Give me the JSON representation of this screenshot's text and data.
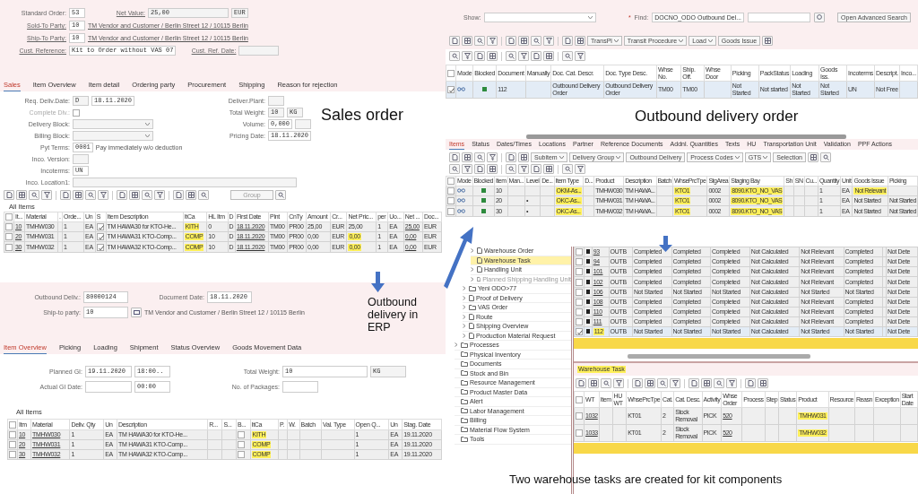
{
  "sales_order": {
    "header_rows": [
      [
        {
          "kind": "input",
          "label": "Standard Order:",
          "link": false,
          "value": "53"
        },
        {
          "kind": "input",
          "label": "Net Value:",
          "link": true,
          "value": "25,00",
          "unit": "EUR"
        }
      ],
      [
        {
          "kind": "input",
          "label": "Sold-To Party:",
          "link": true,
          "value": "10",
          "text": "TM Vendor and Customer / Berlin Street 12 / 10115 Berlin"
        }
      ],
      [
        {
          "kind": "input",
          "label": "Ship-To Party:",
          "link": true,
          "value": "10",
          "text": "TM Vendor and Customer / Berlin Street 12 / 10115 Berlin"
        }
      ],
      [
        {
          "kind": "input",
          "label": "Cust. Reference:",
          "link": true,
          "value": "Kit to Order without VAS 07"
        },
        {
          "kind": "input",
          "label": "Cust. Ref. Date:",
          "link": true
        }
      ]
    ],
    "tabs": [
      {
        "label": "Sales",
        "selected": true
      },
      {
        "label": "Item Overview",
        "selected": false
      },
      {
        "label": "Item detail",
        "selected": false
      },
      {
        "label": "Ordering party",
        "selected": false
      },
      {
        "label": "Procurement",
        "selected": false
      },
      {
        "label": "Shipping",
        "selected": false
      },
      {
        "label": "Reason for rejection",
        "selected": false
      }
    ],
    "form_left": [
      {
        "kind": "input",
        "label": "Req. Deliv.Date:",
        "prefix": "D",
        "value": "18.11.2020"
      },
      {
        "kind": "checkbox",
        "label": "Complete Dlv.:",
        "checked": false,
        "disabled": true
      },
      {
        "kind": "dropdown",
        "label": "Delivery Block:"
      },
      {
        "kind": "dropdown",
        "label": "Billing Block:"
      },
      {
        "kind": "input",
        "label": "Pyt Terms:",
        "value": "0001",
        "text": "Pay immediately w/o deduction"
      },
      {
        "kind": "input",
        "label": "Inco. Version:"
      },
      {
        "kind": "input",
        "label": "Incoterms:",
        "value": "UN"
      },
      {
        "kind": "wide-input",
        "label": "Inco. Location1:"
      }
    ],
    "form_right": [
      {
        "kind": "input",
        "label": "Deliver.Plant:"
      },
      {
        "kind": "input",
        "label": "Total Weight:",
        "value": "10",
        "unit": "KG"
      },
      {
        "kind": "input",
        "label": "Volume:",
        "value": "0,000",
        "unit_box": true
      },
      {
        "kind": "input",
        "label": "Pricing Date:",
        "value": "18.11.2020"
      }
    ],
    "toolbar_buttons": [
      {
        "label": "Group",
        "dropdown": false
      }
    ],
    "table_title": "All Items",
    "table": {
      "row_select": true,
      "all_checked": false,
      "columns": [
        {
          "label": "It...",
          "kind": "link"
        },
        {
          "label": "Material",
          "kind": "text"
        },
        {
          "label": ".",
          "kind": "text"
        },
        {
          "label": "Orde...",
          "kind": "text"
        },
        {
          "label": "Un",
          "kind": "text"
        },
        {
          "label": "S",
          "kind": "check"
        },
        {
          "label": "Item Description",
          "kind": "text"
        },
        {
          "label": "ItCa",
          "kind": "text"
        },
        {
          "label": "HL Itm",
          "kind": "text"
        },
        {
          "label": "D",
          "kind": "text"
        },
        {
          "label": "First Date",
          "kind": "link"
        },
        {
          "label": "Plnt",
          "kind": "text"
        },
        {
          "label": "CnTy",
          "kind": "text"
        },
        {
          "label": "Amount",
          "kind": "text"
        },
        {
          "label": "Cr...",
          "kind": "text"
        },
        {
          "label": "Net Pric...",
          "kind": "text"
        },
        {
          "label": "per",
          "kind": "text"
        },
        {
          "label": "Uo...",
          "kind": "text"
        },
        {
          "label": "Net ...",
          "kind": "link"
        },
        {
          "label": "Doc...",
          "kind": "text"
        }
      ],
      "rows": [
        {
          "checked": false,
          "cells": [
            "10",
            "TMHW030",
            null,
            "1",
            "EA",
            true,
            "TM HAWA30 for KTO-He...",
            {
              "text": "KITH",
              "highlighted": true
            },
            "0",
            "D",
            "18.11.2020",
            "TM00",
            "PR00",
            "25,00",
            "EUR",
            "25,00",
            "1",
            "EA",
            "25,00",
            "EUR"
          ]
        },
        {
          "checked": false,
          "cells": [
            "20",
            "TMHW031",
            null,
            "1",
            "EA",
            true,
            "TM HAWA31 KTO-Comp...",
            {
              "text": "COMP",
              "highlighted": true
            },
            "10",
            "D",
            "18.11.2020",
            "TM00",
            "PR00",
            "0,00",
            "EUR",
            {
              "text": "0,00",
              "highlighted": true
            },
            "1",
            "EA",
            "0,00",
            "EUR"
          ]
        },
        {
          "checked": false,
          "cells": [
            "30",
            "TMHW032",
            null,
            "1",
            "EA",
            true,
            "TM HAWA32 KTO-Comp...",
            {
              "text": "COMP",
              "highlighted": true
            },
            "10",
            "D",
            "18.11.2020",
            "TM00",
            "PR00",
            "0,00",
            "EUR",
            {
              "text": "0,00",
              "highlighted": true
            },
            "1",
            "EA",
            "0,00",
            "EUR"
          ]
        }
      ]
    }
  },
  "delivery": {
    "header_rows": [
      [
        {
          "kind": "input",
          "label": "Outbound Deliv.:",
          "value": "80000124"
        },
        {
          "kind": "input",
          "label": "Document Date:",
          "value": "18.11.2020"
        }
      ],
      [
        {
          "kind": "input",
          "label": "Ship-to party:",
          "value": "10",
          "button": true,
          "text": "TM Vendor and Customer / Berlin Street 12 / 10115 Berlin"
        }
      ]
    ],
    "tabs": [
      {
        "label": "Item Overview",
        "selected": true
      },
      {
        "label": "Picking",
        "selected": false
      },
      {
        "label": "Loading",
        "selected": false
      },
      {
        "label": "Shipment",
        "selected": false
      },
      {
        "label": "Status Overview",
        "selected": false
      },
      {
        "label": "Goods Movement Data",
        "selected": false
      }
    ],
    "form_left": [
      {
        "kind": "input",
        "label": "Planned GI:",
        "value": "19.11.2020",
        "time": "18:00.."
      },
      {
        "kind": "input",
        "label": "Actual GI Date:",
        "time": "00:00"
      }
    ],
    "form_right": [
      {
        "kind": "input",
        "label": "Total Weight:",
        "value": "10",
        "unit": "KG"
      },
      {
        "kind": "input",
        "label": "No. of Packages:"
      }
    ],
    "table_title": "All Items",
    "table": {
      "row_select": true,
      "all_checked": false,
      "columns": [
        {
          "label": "Itm",
          "kind": "link"
        },
        {
          "label": "Material",
          "kind": "link"
        },
        {
          "label": "Deliv. Qty",
          "kind": "text"
        },
        {
          "label": "Un",
          "kind": "text"
        },
        {
          "label": "Description",
          "kind": "text"
        },
        {
          "label": "R...",
          "kind": "text"
        },
        {
          "label": "S...",
          "kind": "text"
        },
        {
          "label": "B...",
          "kind": "check"
        },
        {
          "label": "ItCa",
          "kind": "text"
        },
        {
          "label": "P.",
          "kind": "text"
        },
        {
          "label": "W.",
          "kind": "text"
        },
        {
          "label": "Batch",
          "kind": "text"
        },
        {
          "label": "Val. Type",
          "kind": "text"
        },
        {
          "label": "Open Q...",
          "kind": "text"
        },
        {
          "label": "Un",
          "kind": "text"
        },
        {
          "label": "Stag. Date",
          "kind": "text"
        }
      ],
      "rows": [
        {
          "checked": false,
          "cells": [
            "10",
            "TMHW030",
            "1",
            "EA",
            "TM HAWA30 for KTO-He...",
            null,
            null,
            false,
            {
              "text": "KITH",
              "highlighted": true
            },
            null,
            null,
            null,
            null,
            "1",
            "EA",
            "19.11.2020"
          ]
        },
        {
          "checked": false,
          "cells": [
            "20",
            "TMHW031",
            "1",
            "EA",
            "TM HAWA31 KTO-Comp...",
            null,
            null,
            false,
            {
              "text": "COMP",
              "highlighted": true
            },
            null,
            null,
            null,
            null,
            "1",
            "EA",
            "19.11.2020"
          ]
        },
        {
          "checked": false,
          "cells": [
            "30",
            "TMHW032",
            "1",
            "EA",
            "TM HAWA32 KTO-Comp...",
            null,
            null,
            false,
            {
              "text": "COMP",
              "highlighted": true
            },
            null,
            null,
            null,
            null,
            "1",
            "EA",
            "19.11.2020"
          ]
        }
      ]
    }
  },
  "odo_list": {
    "show_label": "Show:",
    "required_mark": "*",
    "find_label": "Find:",
    "find_value": "DOCNO_ODO Outbound Del...",
    "advanced_search": "Open Advanced Search",
    "toolbar_buttons": [
      {
        "label": "TransPl",
        "dropdown": true
      },
      {
        "label": "Transit Procedure",
        "dropdown": true
      },
      {
        "label": "Load",
        "dropdown": true
      },
      {
        "label": "Goods Issue",
        "dropdown": false
      }
    ],
    "table": {
      "row_select": true,
      "all_checked": false,
      "columns": [
        {
          "label": "Mode",
          "kind": "glasses"
        },
        {
          "label": "Blocked",
          "kind": "square"
        },
        {
          "label": "Document",
          "kind": "text"
        },
        {
          "label": "Manually",
          "kind": "text"
        },
        {
          "label": "Doc. Cat. Descr.",
          "kind": "text"
        },
        {
          "label": "Doc. Type Desc.",
          "kind": "text"
        },
        {
          "label": "Whse No.",
          "kind": "text"
        },
        {
          "label": "Ship. Off.",
          "kind": "text"
        },
        {
          "label": "Whse Door",
          "kind": "text"
        },
        {
          "label": "Picking",
          "kind": "text"
        },
        {
          "label": "PackStatus",
          "kind": "text"
        },
        {
          "label": "Loading",
          "kind": "text"
        },
        {
          "label": "Goods Iss.",
          "kind": "text"
        },
        {
          "label": "Incoterms",
          "kind": "text"
        },
        {
          "label": "Descript.",
          "kind": "text"
        },
        {
          "label": "Inco...",
          "kind": "text"
        }
      ],
      "rows": [
        {
          "checked": true,
          "cells": [
            null,
            null,
            "112",
            null,
            "Outbound Delivery Order",
            "Outbound Delivery Order",
            "TM00",
            "TM00",
            null,
            "Not Started",
            "Not started",
            "Not Started",
            "Not Started",
            "UN",
            "Not Free",
            null
          ]
        }
      ]
    }
  },
  "odo_items": {
    "tabs": [
      {
        "label": "Items",
        "selected": true
      },
      {
        "label": "Status",
        "selected": false
      },
      {
        "label": "Dates/Times",
        "selected": false
      },
      {
        "label": "Locations",
        "selected": false
      },
      {
        "label": "Partner",
        "selected": false
      },
      {
        "label": "Reference Documents",
        "selected": false
      },
      {
        "label": "Addnl. Quantities",
        "selected": false
      },
      {
        "label": "Texts",
        "selected": false
      },
      {
        "label": "HU",
        "selected": false
      },
      {
        "label": "Transportation Unit",
        "selected": false
      },
      {
        "label": "Validation",
        "selected": false
      },
      {
        "label": "PPF Actions",
        "selected": false
      }
    ],
    "toolbar_buttons": [
      {
        "label": "Subitem",
        "dropdown": true
      },
      {
        "label": "Delivery Group",
        "dropdown": true
      },
      {
        "label": "Outbound Delivery",
        "dropdown": false
      },
      {
        "label": "Process Codes",
        "dropdown": true
      },
      {
        "label": "GTS",
        "dropdown": true
      },
      {
        "label": "Selection",
        "dropdown": false
      }
    ],
    "table": {
      "row_select": true,
      "all_checked": false,
      "columns": [
        {
          "label": "Mode",
          "kind": "glasses"
        },
        {
          "label": "Blocked",
          "kind": "square"
        },
        {
          "label": "Item",
          "kind": "text"
        },
        {
          "label": "Man...",
          "kind": "text"
        },
        {
          "label": "Level",
          "kind": "text"
        },
        {
          "label": "De...",
          "kind": "text"
        },
        {
          "label": "Item Type",
          "kind": "text"
        },
        {
          "label": "D...",
          "kind": "text"
        },
        {
          "label": "Product",
          "kind": "text"
        },
        {
          "label": "Description",
          "kind": "text"
        },
        {
          "label": "Batch",
          "kind": "text"
        },
        {
          "label": "WhsePrcTpe",
          "kind": "text"
        },
        {
          "label": "StgArea",
          "kind": "text"
        },
        {
          "label": "Staging Bay",
          "kind": "text"
        },
        {
          "label": "Sh",
          "kind": "text"
        },
        {
          "label": "SN",
          "kind": "text"
        },
        {
          "label": "Cu...",
          "kind": "text"
        },
        {
          "label": "Quantity",
          "kind": "text"
        },
        {
          "label": "Unit",
          "kind": "text"
        },
        {
          "label": "Goods Issue",
          "kind": "text"
        },
        {
          "label": "Picking",
          "kind": "text"
        }
      ],
      "rows": [
        {
          "checked": false,
          "cells": [
            null,
            null,
            "10",
            null,
            null,
            null,
            {
              "text": "OKM-As...",
              "highlighted": true
            },
            null,
            "TMHW030",
            "TM HAWA...",
            null,
            {
              "text": "KTO1",
              "highlighted": true
            },
            "0002",
            {
              "text": "8090.KTO_NO_VAS",
              "highlighted": true
            },
            null,
            null,
            null,
            "1",
            "EA",
            {
              "text": "Not Relevant",
              "highlighted": true
            },
            null
          ]
        },
        {
          "checked": false,
          "cells": [
            null,
            null,
            "20",
            null,
            "•",
            null,
            {
              "text": "OKC-As...",
              "highlighted": true
            },
            null,
            "TMHW031",
            "TM HAWA...",
            null,
            {
              "text": "KTO1",
              "highlighted": true
            },
            "0002",
            {
              "text": "8090.KTO_NO_VAS",
              "highlighted": true
            },
            null,
            null,
            null,
            "1",
            "EA",
            "Not Started",
            "Not Started"
          ]
        },
        {
          "checked": false,
          "cells": [
            null,
            null,
            "30",
            null,
            "•",
            null,
            {
              "text": "OKC-As...",
              "highlighted": true
            },
            null,
            "TMHW032",
            "TM HAWA...",
            null,
            {
              "text": "KTO1",
              "highlighted": true
            },
            "0002",
            {
              "text": "8090.KTO_NO_VAS",
              "highlighted": true
            },
            null,
            null,
            null,
            "1",
            "EA",
            "Not Started",
            "Not Started"
          ]
        }
      ]
    }
  },
  "wt_monitor": {
    "tree": [
      {
        "children": [
          {
            "children": [
              {
                "label": "Warehouse Order",
                "kind": "document",
                "expandable": true,
                "selected": false,
                "disabled": false
              },
              {
                "label": "Warehouse Task",
                "kind": "document",
                "expandable": false,
                "selected": true,
                "disabled": false
              },
              {
                "label": "Handling Unit",
                "kind": "document",
                "expandable": true,
                "selected": false,
                "disabled": false
              },
              {
                "label": "Planned Shipping Handling Unit",
                "kind": "document",
                "expandable": true,
                "selected": false,
                "disabled": true
              }
            ]
          },
          {
            "label": "Yeni ODO>77",
            "kind": "folder",
            "expandable": true,
            "selected": false,
            "disabled": false
          },
          {
            "label": "Proof of Delivery",
            "kind": "document",
            "expandable": true,
            "selected": false,
            "disabled": false
          },
          {
            "label": "VAS Order",
            "kind": "folder",
            "expandable": true,
            "selected": false,
            "disabled": false
          },
          {
            "label": "Route",
            "kind": "document",
            "expandable": true,
            "selected": false,
            "disabled": false
          },
          {
            "label": "Shipping Overview",
            "kind": "document",
            "expandable": true,
            "selected": false,
            "disabled": false
          },
          {
            "label": "Production Material Request",
            "kind": "document",
            "expandable": true,
            "selected": false,
            "disabled": false
          }
        ]
      },
      {
        "label": "Processes",
        "kind": "folder",
        "expandable": true,
        "selected": false,
        "disabled": false
      },
      {
        "label": "Physical Inventory",
        "kind": "folder",
        "expandable": false,
        "selected": false,
        "disabled": false
      },
      {
        "label": "Documents",
        "kind": "folder",
        "expandable": false,
        "selected": false,
        "disabled": false
      },
      {
        "label": "Stock and Bin",
        "kind": "folder",
        "expandable": false,
        "selected": false,
        "disabled": false
      },
      {
        "label": "Resource Management",
        "kind": "folder",
        "expandable": false,
        "selected": false,
        "disabled": false
      },
      {
        "label": "Product Master Data",
        "kind": "folder",
        "expandable": false,
        "selected": false,
        "disabled": false
      },
      {
        "label": "Alert",
        "kind": "folder",
        "expandable": false,
        "selected": false,
        "disabled": false
      },
      {
        "label": "Labor Management",
        "kind": "folder",
        "expandable": false,
        "selected": false,
        "disabled": false
      },
      {
        "label": "Billing",
        "kind": "folder",
        "expandable": false,
        "selected": false,
        "disabled": false
      },
      {
        "label": "Material Flow System",
        "kind": "folder",
        "expandable": false,
        "selected": false,
        "disabled": false
      },
      {
        "label": "Tools",
        "kind": "folder",
        "expandable": false,
        "selected": false,
        "disabled": false
      }
    ],
    "grid": {
      "row_select": true,
      "columns": [
        {
          "kind": "block"
        },
        {
          "kind": "link"
        },
        {
          "kind": "text"
        },
        {
          "kind": "text"
        },
        {
          "kind": "text"
        },
        {
          "kind": "text"
        },
        {
          "kind": "text"
        },
        {
          "kind": "text"
        },
        {
          "kind": "text"
        },
        {
          "kind": "text"
        },
        {
          "kind": "text"
        }
      ],
      "rows": [
        {
          "checked": false,
          "cells": [
            null,
            "93",
            "OUTB",
            "Completed",
            "Completed",
            "Completed",
            "Not Calculated",
            "Not Relevant",
            "Completed",
            null,
            "Not Dete"
          ]
        },
        {
          "checked": false,
          "cells": [
            null,
            "94",
            "OUTB",
            "Completed",
            "Completed",
            "Completed",
            "Not Calculated",
            "Not Relevant",
            "Completed",
            null,
            "Not Dete"
          ]
        },
        {
          "checked": false,
          "cells": [
            null,
            "101",
            "OUTB",
            "Completed",
            "Completed",
            "Completed",
            "Not Calculated",
            "Not Relevant",
            "Completed",
            null,
            "Not Dete"
          ]
        },
        {
          "checked": false,
          "cells": [
            null,
            "102",
            "OUTB",
            "Completed",
            "Completed",
            "Completed",
            "Not Calculated",
            "Not Relevant",
            "Completed",
            null,
            "Not Dete"
          ]
        },
        {
          "checked": false,
          "cells": [
            null,
            "106",
            "OUTB",
            "Not Started",
            "Not Started",
            "Not Started",
            "Not Calculated",
            "Not Started",
            "Not Started",
            null,
            "Not Dete"
          ]
        },
        {
          "checked": false,
          "cells": [
            null,
            "108",
            "OUTB",
            "Completed",
            "Completed",
            "Completed",
            "Not Calculated",
            "Not Relevant",
            "Completed",
            null,
            "Not Dete"
          ]
        },
        {
          "checked": false,
          "cells": [
            null,
            "110",
            "OUTB",
            "Completed",
            "Completed",
            "Completed",
            "Not Calculated",
            "Not Relevant",
            "Completed",
            null,
            "Not Dete"
          ]
        },
        {
          "checked": false,
          "cells": [
            null,
            "111",
            "OUTB",
            "Completed",
            "Completed",
            "Completed",
            "Not Calculated",
            "Not Relevant",
            "Completed",
            null,
            "Not Dete"
          ]
        },
        {
          "checked": true,
          "cells": [
            null,
            {
              "text": "112",
              "highlighted": true
            },
            "OUTB",
            "Not Started",
            "Not Started",
            "Not Started",
            "Not Calculated",
            "Not Started",
            "Not Started",
            null,
            "Not Dete"
          ]
        }
      ]
    },
    "task_title": "Warehouse Task",
    "tasks": {
      "row_select": true,
      "all_checked": false,
      "columns": [
        {
          "label": "WT",
          "kind": "link"
        },
        {
          "label": "Item",
          "kind": "text"
        },
        {
          "label": "HU WT",
          "kind": "text"
        },
        {
          "label": "WhsePrcTpe",
          "kind": "text"
        },
        {
          "label": "Cat.",
          "kind": "text"
        },
        {
          "label": "Cat. Desc.",
          "kind": "text"
        },
        {
          "label": "Activity",
          "kind": "text"
        },
        {
          "label": "Whse Order",
          "kind": "link"
        },
        {
          "label": "Process",
          "kind": "text"
        },
        {
          "label": "Step",
          "kind": "text"
        },
        {
          "label": "Status",
          "kind": "text"
        },
        {
          "label": "Product",
          "kind": "link"
        },
        {
          "label": "Resource",
          "kind": "text"
        },
        {
          "label": "Reasn",
          "kind": "text"
        },
        {
          "label": "Exception",
          "kind": "text"
        },
        {
          "label": "Start Date",
          "kind": "text"
        }
      ],
      "rows": [
        {
          "checked": false,
          "cells": [
            "1032",
            null,
            null,
            "KT01",
            "2",
            "Stock Removal",
            "PICK",
            "520",
            null,
            null,
            null,
            {
              "text": "TMHW031",
              "highlighted": true
            },
            null,
            null,
            null,
            null
          ]
        },
        {
          "checked": false,
          "cells": [
            "1033",
            null,
            null,
            "KT01",
            "2",
            "Stock Removal",
            "PICK",
            "520",
            null,
            null,
            null,
            {
              "text": "TMHW032",
              "highlighted": true
            },
            null,
            null,
            null,
            null
          ]
        }
      ]
    }
  },
  "annotations": [
    {
      "text": "Sales order"
    },
    {
      "text": "Outbound delivery order"
    },
    {
      "text": "Outbound delivery in ERP"
    },
    {
      "text": "Two warehouse tasks are created for kit components"
    }
  ]
}
